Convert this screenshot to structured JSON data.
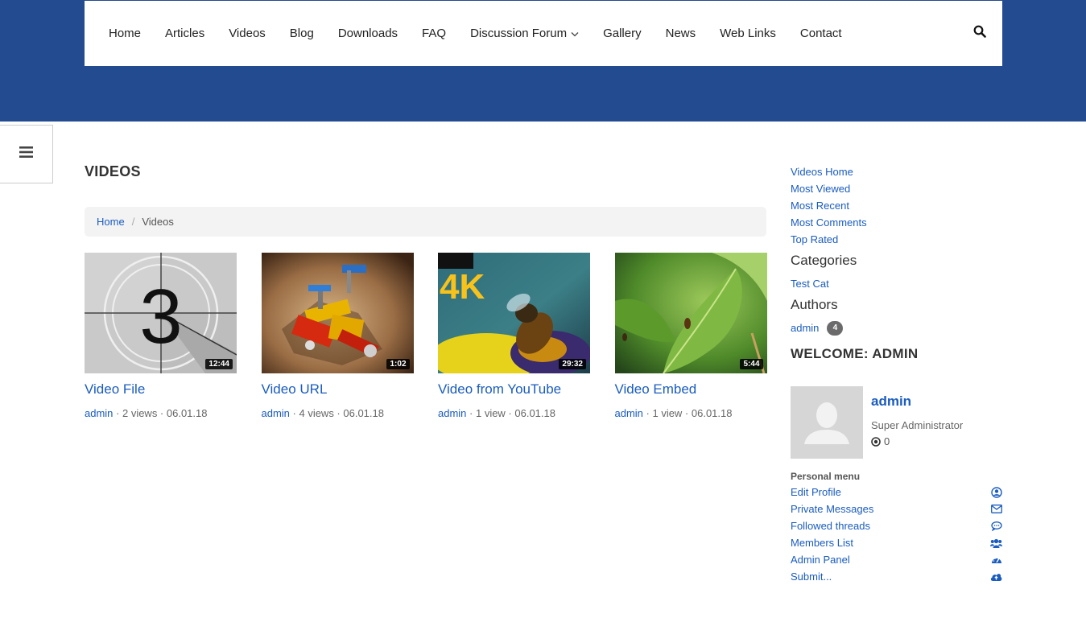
{
  "nav": {
    "items": [
      "Home",
      "Articles",
      "Videos",
      "Blog",
      "Downloads",
      "FAQ",
      "Discussion Forum",
      "Gallery",
      "News",
      "Web Links",
      "Contact"
    ],
    "dropdown_item": "Discussion Forum"
  },
  "page": {
    "title": "VIDEOS"
  },
  "breadcrumb": {
    "home": "Home",
    "current": "Videos"
  },
  "videos": [
    {
      "title": "Video File",
      "duration": "12:44",
      "author": "admin",
      "stats": " · 2 views · 06.01.18"
    },
    {
      "title": "Video URL",
      "duration": "1:02",
      "author": "admin",
      "stats": " · 4 views · 06.01.18"
    },
    {
      "title": "Video from YouTube",
      "duration": "29:32",
      "author": "admin",
      "stats": " · 1 view · 06.01.18",
      "overlay": "4K"
    },
    {
      "title": "Video Embed",
      "duration": "5:44",
      "author": "admin",
      "stats": " · 1 view · 06.01.18"
    }
  ],
  "sidebar": {
    "links": [
      "Videos Home",
      "Most Viewed",
      "Most Recent",
      "Most Comments",
      "Top Rated"
    ],
    "categories_heading": "Categories",
    "categories": [
      "Test Cat"
    ],
    "authors_heading": "Authors",
    "author": {
      "name": "admin",
      "count": "4"
    },
    "welcome": "WELCOME: ADMIN",
    "profile": {
      "name": "admin",
      "role": "Super Administrator",
      "points": "0"
    },
    "personal_menu_title": "Personal menu",
    "personal_menu": [
      {
        "label": "Edit Profile",
        "icon": "user-circle-icon"
      },
      {
        "label": "Private Messages",
        "icon": "envelope-icon"
      },
      {
        "label": "Followed threads",
        "icon": "comments-icon"
      },
      {
        "label": "Members List",
        "icon": "users-icon"
      },
      {
        "label": "Admin Panel",
        "icon": "dashboard-icon"
      },
      {
        "label": "Submit...",
        "icon": "cloud-upload-icon"
      }
    ]
  },
  "colors": {
    "header_bg": "#234b8f",
    "link": "#1a5cbf"
  }
}
